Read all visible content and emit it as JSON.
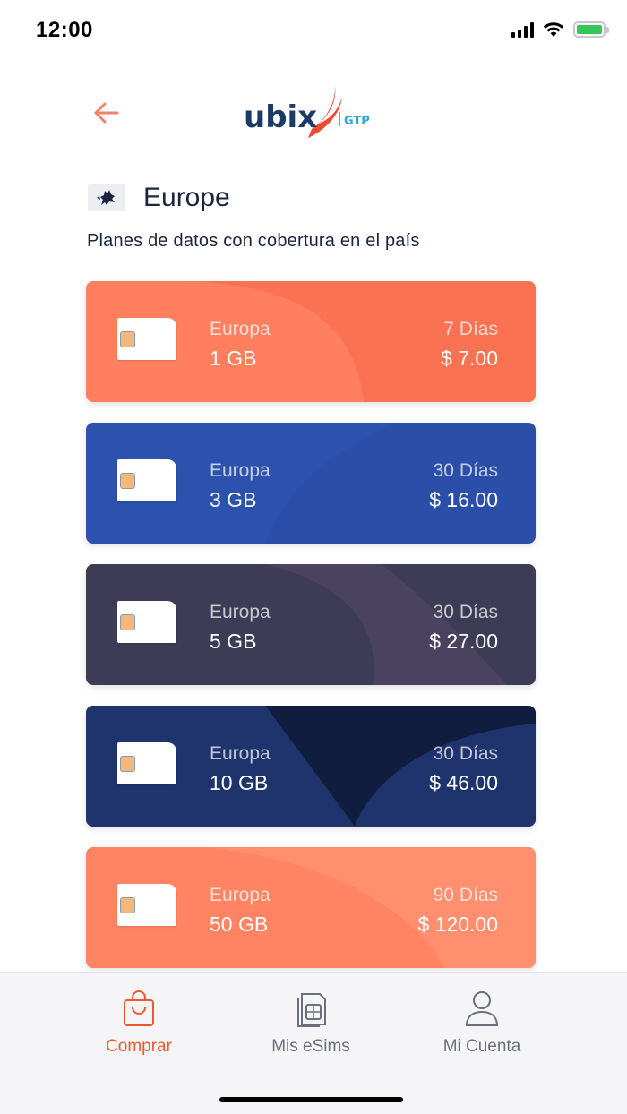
{
  "status_bar": {
    "time": "12:00",
    "battery_level": 1.0
  },
  "header": {
    "back_icon": "arrow-left-icon",
    "logo_text": "ubix",
    "logo_suffix": "GTP"
  },
  "region": {
    "flag_icon": "europe-map-icon",
    "name": "Europe"
  },
  "subtitle": "Planes de datos con cobertura en el país",
  "plans": [
    {
      "region": "Europa",
      "data": "1 GB",
      "duration": "7 Días",
      "price": "$ 7.00",
      "color": "#ff7f5f",
      "accent": "#fa6c4f"
    },
    {
      "region": "Europa",
      "data": "3 GB",
      "duration": "30 Días",
      "price": "$ 16.00",
      "color": "#2b4ea8",
      "accent": "#2f55b4"
    },
    {
      "region": "Europa",
      "data": "5 GB",
      "duration": "30 Días",
      "price": "$ 27.00",
      "color": "#3d3b55",
      "accent": "#4a4560"
    },
    {
      "region": "Europa",
      "data": "10 GB",
      "duration": "30 Días",
      "price": "$ 46.00",
      "color": "#111d3f",
      "accent": "#1f346c"
    },
    {
      "region": "Europa",
      "data": "50 GB",
      "duration": "90 Días",
      "price": "$ 120.00",
      "color": "#ff8464",
      "accent": "#ff9675"
    }
  ],
  "nav": {
    "buy_label": "Comprar",
    "esims_label": "Mis eSims",
    "account_label": "Mi Cuenta",
    "active": "buy"
  },
  "colors": {
    "accent": "#ec5a2c",
    "text": "#1c2440",
    "inactive": "#6b6f7a"
  }
}
